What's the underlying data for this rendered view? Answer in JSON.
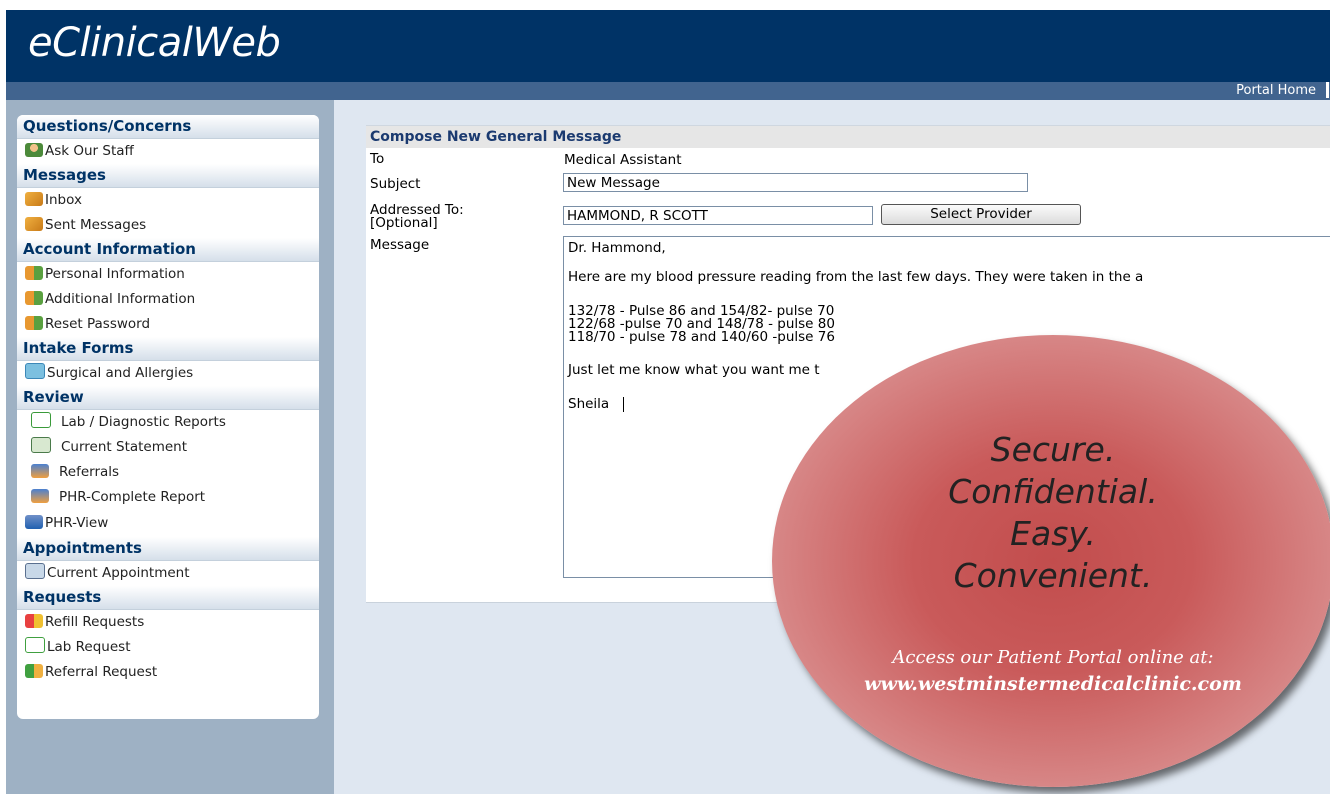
{
  "app": {
    "logo": "eClinicalWeb",
    "portal_home": "Portal Home"
  },
  "sidebar": {
    "sections": [
      {
        "title": "Questions/Concerns",
        "items": [
          {
            "label": "Ask Our Staff",
            "icon": "staff-icon"
          }
        ]
      },
      {
        "title": "Messages",
        "items": [
          {
            "label": "Inbox",
            "icon": "mail-icon"
          },
          {
            "label": "Sent Messages",
            "icon": "mail-icon"
          }
        ]
      },
      {
        "title": "Account Information",
        "items": [
          {
            "label": "Personal Information",
            "icon": "users-icon"
          },
          {
            "label": "Additional Information",
            "icon": "users-icon"
          },
          {
            "label": "Reset Password",
            "icon": "users-icon"
          }
        ]
      },
      {
        "title": "Intake Forms",
        "items": [
          {
            "label": "Surgical and Allergies",
            "icon": "folder-icon"
          }
        ]
      },
      {
        "title": "Review",
        "items": [
          {
            "label": "Lab / Diagnostic Reports",
            "icon": "lab-chart-icon"
          },
          {
            "label": "Current Statement",
            "icon": "statement-icon"
          },
          {
            "label": "Referrals",
            "icon": "referral-icon"
          },
          {
            "label": "PHR-Complete Report",
            "icon": "report-icon"
          },
          {
            "label": "PHR-View",
            "icon": "phr-view-icon"
          }
        ]
      },
      {
        "title": "Appointments",
        "items": [
          {
            "label": "Current Appointment",
            "icon": "calendar-icon"
          }
        ]
      },
      {
        "title": "Requests",
        "items": [
          {
            "label": "Refill Requests",
            "icon": "refill-icon"
          },
          {
            "label": "Lab Request",
            "icon": "lab-request-icon"
          },
          {
            "label": "Referral Request",
            "icon": "referral-request-icon"
          }
        ]
      }
    ]
  },
  "compose": {
    "title": "Compose New General Message",
    "to_label": "To",
    "to_value": "Medical Assistant",
    "subject_label": "Subject",
    "subject_value": "New Message",
    "addressed_label_1": "Addressed To:",
    "addressed_label_2": "[Optional]",
    "addressed_value": "HAMMOND, R SCOTT",
    "select_provider": "Select Provider",
    "message_label": "Message",
    "message_lines": [
      " Dr. Hammond,",
      "Here are my blood pressure reading from the last few days.  They were taken in the a",
      "132/78 - Pulse 86  and 154/82- pulse 70",
      "122/68 -pulse 70  and  148/78 - pulse 80",
      "118/70 - pulse 78 and 140/60 -pulse 76",
      "Just let me know what you want me t",
      "Sheila"
    ]
  },
  "promo": {
    "lines": [
      "Secure.",
      "Confidential.",
      "Easy.",
      "Convenient."
    ],
    "access_text": "Access our Patient Portal online at:",
    "url": "www.westminstermedicalclinic.com"
  }
}
